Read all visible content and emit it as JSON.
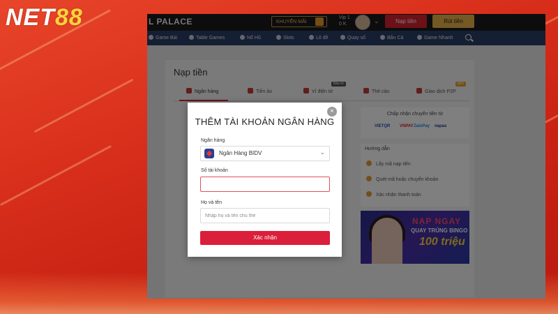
{
  "logo": {
    "part1": "NET",
    "part2": "88"
  },
  "site": {
    "brand": "L PALACE",
    "promo_label": "KHUYẾN MÃI",
    "vip_label": "Vip 1",
    "balance": "0 K",
    "deposit_button": "Nạp tiền",
    "withdraw_button": "Rút tiền"
  },
  "nav": {
    "items": [
      "Game Bài",
      "Table Games",
      "Nổ Hũ",
      "Slots",
      "Lô đề",
      "Quay số",
      "Bắn Cá",
      "Game Nhanh"
    ]
  },
  "page": {
    "title": "Nạp tiền",
    "tabs": [
      {
        "label": "Ngân hàng",
        "badge": ""
      },
      {
        "label": "Tiền ảo",
        "badge": ""
      },
      {
        "label": "Ví điện tử",
        "badge": "Bảo trì"
      },
      {
        "label": "Thẻ cào",
        "badge": ""
      },
      {
        "label": "Giao dịch P2P",
        "badge": "Mới"
      }
    ]
  },
  "sidebar": {
    "accept_title": "Chấp nhận chuyển tiền từ",
    "providers": [
      "VIETQR",
      "VNPAY",
      "ZaloPay",
      "napas"
    ],
    "guide_title": "Hướng dẫn",
    "steps": [
      "Lấy mã nạp tiền",
      "Quét mã hoặc chuyển khoản",
      "Xác nhận thanh toán"
    ],
    "banner": {
      "line1": "NẠP NGAY",
      "line2": "QUAY TRÚNG BINGO",
      "line3": "100 triệu"
    }
  },
  "modal": {
    "title": "THÊM TÀI KHOẢN NGÂN HÀNG",
    "close": "×",
    "bank_label": "Ngân hàng",
    "bank_value": "Ngân Hàng BIDV",
    "account_label": "Số tài khoản",
    "account_value": "",
    "name_label": "Họ và tên",
    "name_placeholder": "Nhập họ và tên chủ thẻ",
    "submit_label": "Xác nhận"
  },
  "colors": {
    "accent": "#db1e3a",
    "nav_bg": "#2a3f66",
    "topbar_bg": "#1b1b1d",
    "background": "#d9301c"
  }
}
